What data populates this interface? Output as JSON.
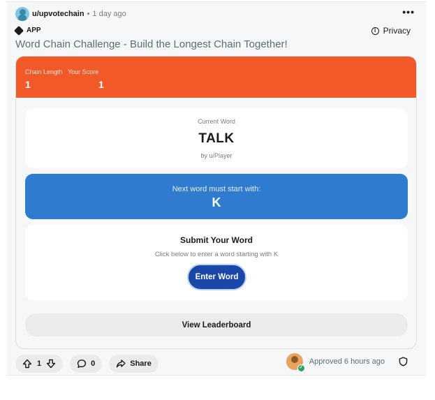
{
  "post": {
    "author": "u/upvotechain",
    "separator": "•",
    "time": "1 day ago",
    "more": "•••",
    "app_badge": "APP",
    "privacy": "Privacy",
    "title": "Word Chain Challenge - Build the Longest Chain Together!"
  },
  "game": {
    "stats": {
      "chain_length_label": "Chain Length",
      "chain_length_value": "1",
      "score_label": "Your Score",
      "score_value": "1"
    },
    "current": {
      "label": "Current Word",
      "word": "TALK",
      "by": "by u/Player"
    },
    "next": {
      "label": "Next word must start with:",
      "letter": "K"
    },
    "submit": {
      "title": "Submit Your Word",
      "hint": "Click below to enter a word starting with K",
      "button": "Enter Word"
    },
    "leaderboard_button": "View Leaderboard"
  },
  "actions": {
    "votes": "1",
    "comments": "0",
    "share": "Share",
    "approved": "Approved 6 hours ago"
  },
  "colors": {
    "stats_bar": "#f15a28",
    "next_card": "#2f7bd0",
    "enter_button": "#1a47a8"
  }
}
